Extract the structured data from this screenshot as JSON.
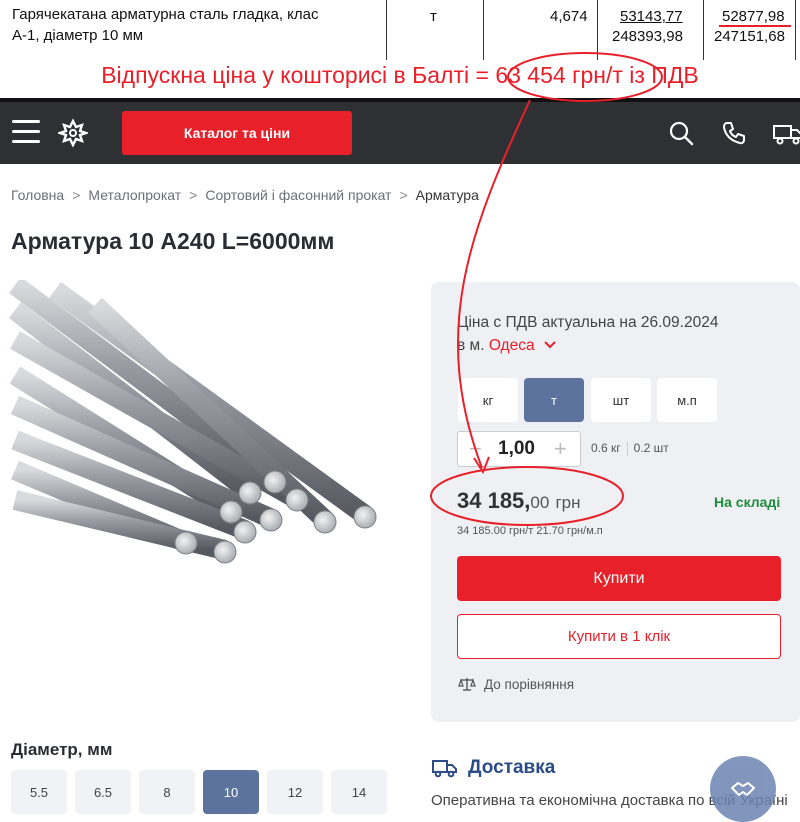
{
  "estimate_row": {
    "description_line1": "Гарячекатана арматурна сталь гладка, клас",
    "description_line2": "А-1, діаметр 10 мм",
    "unit": "т",
    "quantity": "4,674",
    "price_1": "53143,77",
    "price_2": "52877,98",
    "total_1": "248393,98",
    "total_2": "247151,68"
  },
  "annotation": "Відпускна ціна у кошторисі в Балті = 63 454 грн/т із ПДВ",
  "header": {
    "catalog_button": "Каталог та ціни"
  },
  "breadcrumb": {
    "items": [
      "Головна",
      "Металопрокат",
      "Сортовий і фасонний прокат",
      "Арматура"
    ],
    "separator": ">"
  },
  "product": {
    "title": "Арматура 10 A240 L=6000мм"
  },
  "price_panel": {
    "note_line1": "Ціна с ПДВ актуальна на 26.09.2024",
    "city_prefix": "в м.",
    "city": "Одеса",
    "units": [
      "кг",
      "т",
      "шт",
      "м.п"
    ],
    "active_unit": "т",
    "quantity_value": "1,00",
    "qty_info_kg": "0.6 кг",
    "qty_info_pcs": "0.2 шт",
    "price_whole": "34 185,",
    "price_cents": "00",
    "currency": "грн",
    "stock": "На складі",
    "price_sub": "34 185.00 грн/т   21.70 грн/м.п",
    "buy_button": "Купити",
    "buy_one_click_button": "Купити в 1 клік",
    "compare_link": "До порівняння"
  },
  "diameter": {
    "label": "Діаметр, мм",
    "options": [
      "5.5",
      "6.5",
      "8",
      "10",
      "12",
      "14"
    ],
    "active": "10"
  },
  "delivery": {
    "title": "Доставка",
    "text": "Оперативна та економічна доставка по всій Україні"
  },
  "colors": {
    "accent_red": "#e8202a",
    "header_dark": "#2f3033",
    "active_blue": "#5b739d",
    "stock_green": "#1e8c3a"
  }
}
